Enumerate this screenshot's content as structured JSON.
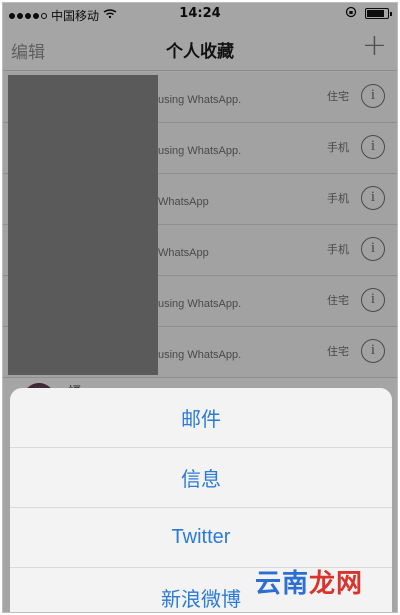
{
  "status_bar": {
    "carrier": "中国移动",
    "wifi_icon": "wifi-icon",
    "time": "14:24",
    "lock_icon": "rotation-lock-icon",
    "battery_icon": "battery-icon"
  },
  "nav": {
    "edit_label": "编辑",
    "title": "个人收藏",
    "add_label": "+"
  },
  "favorites": [
    {
      "subtitle": "using WhatsApp.",
      "type": "住宅"
    },
    {
      "subtitle": "using WhatsApp.",
      "type": "手机"
    },
    {
      "subtitle": "WhatsApp",
      "type": "手机"
    },
    {
      "subtitle": "WhatsApp",
      "type": "手机"
    },
    {
      "subtitle": "using WhatsApp.",
      "type": "住宅"
    },
    {
      "subtitle": "using WhatsApp.",
      "type": "住宅"
    }
  ],
  "info_glyph": "i",
  "partial_row": {
    "name": "福..."
  },
  "action_sheet": {
    "items": [
      "邮件",
      "信息",
      "Twitter",
      "新浪微博"
    ]
  },
  "watermark": {
    "part1": "云南",
    "part2": "龙网"
  },
  "colors": {
    "accent": "#2a7bd6",
    "overlay": "rgba(0,0,0,0.33)"
  }
}
